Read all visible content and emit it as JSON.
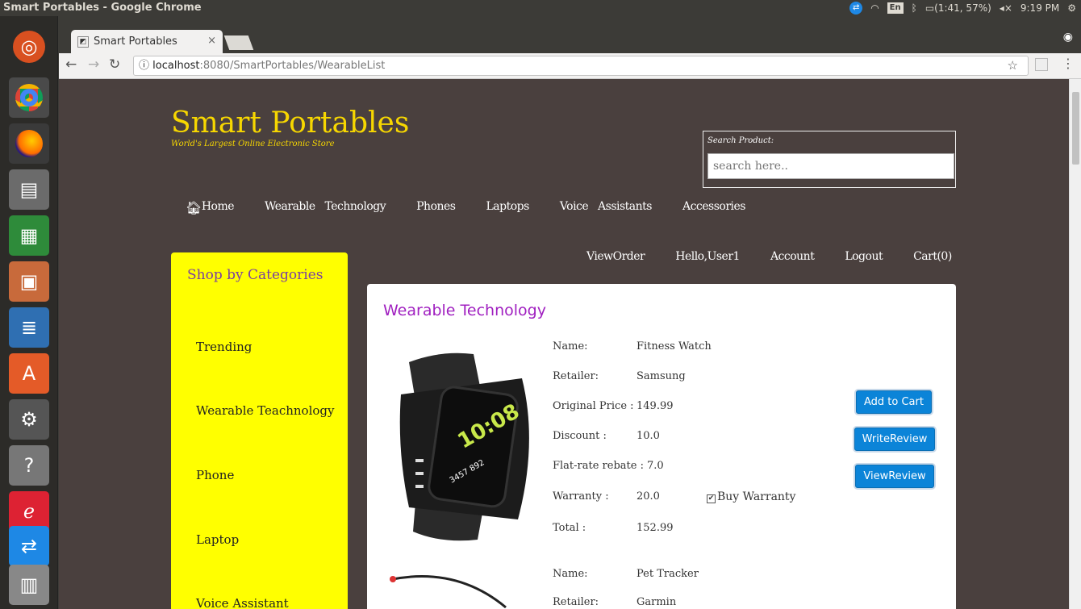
{
  "system": {
    "window_title": "Smart Portables - Google Chrome",
    "indicator_lang": "En",
    "battery": "(1:41, 57%)",
    "time": "9:19 PM"
  },
  "browser": {
    "tab_title": "Smart Portables",
    "url_host": "localhost",
    "url_path": ":8080/SmartPortables/WearableList"
  },
  "site": {
    "brand": "Smart Portables",
    "tagline": "World's Largest Online Electronic Store",
    "search_label": "Search Product:",
    "search_placeholder": "search here..",
    "nav": {
      "home": "Home",
      "wearable": "Wearable   Technology",
      "phones": "Phones",
      "laptops": "Laptops",
      "voice": "Voice   Assistants",
      "accessories": "Accessories"
    },
    "user_nav": {
      "view_order": "ViewOrder",
      "hello": "Hello,User1",
      "account": "Account",
      "logout": "Logout",
      "cart": "Cart(0)"
    }
  },
  "sidebar": {
    "heading": "Shop by Categories",
    "items": [
      "Trending",
      "Wearable Teachnology",
      "Phone",
      "Laptop",
      "Voice Assistant"
    ]
  },
  "content": {
    "title": "Wearable Technology",
    "product1": {
      "name_label": "Name:",
      "name": "Fitness Watch",
      "retailer_label": "Retailer:",
      "retailer": "Samsung",
      "price_label": "Original Price :",
      "price": "149.99",
      "discount_label": "Discount :",
      "discount": "10.0",
      "rebate_label": "Flat-rate rebate :",
      "rebate": "7.0",
      "warranty_label": "Warranty :",
      "warranty": "20.0",
      "buy_warranty": "Buy Warranty",
      "total_label": "Total :",
      "total": "152.99"
    },
    "product2": {
      "name_label": "Name:",
      "name": "Pet Tracker",
      "retailer_label": "Retailer:",
      "retailer": "Garmin"
    },
    "buttons": {
      "add_to_cart": "Add to Cart",
      "write_review": "WriteReview",
      "view_review": "ViewReview"
    }
  }
}
